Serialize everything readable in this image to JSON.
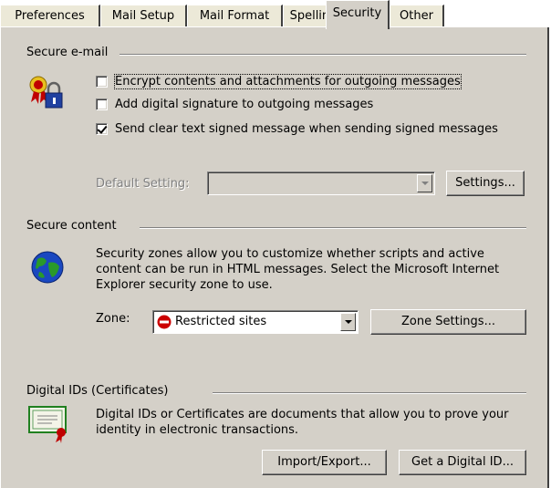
{
  "tabs": [
    {
      "label": "Preferences"
    },
    {
      "label": "Mail Setup"
    },
    {
      "label": "Mail Format"
    },
    {
      "label": "Spelling"
    },
    {
      "label": "Security"
    },
    {
      "label": "Other"
    }
  ],
  "active_tab": "Security",
  "secure_email": {
    "title": "Secure e-mail",
    "icon": "lock-ribbon-icon",
    "encrypt": {
      "label": "Encrypt contents and attachments for outgoing messages",
      "checked": false
    },
    "signature": {
      "label": "Add digital signature to outgoing messages",
      "checked": false
    },
    "clear_text": {
      "label": "Send clear text signed message when sending signed messages",
      "checked": true
    },
    "default_setting_label": "Default Setting:",
    "default_setting_value": "",
    "settings_button": "Settings..."
  },
  "secure_content": {
    "title": "Secure content",
    "icon": "globe-icon",
    "description": "Security zones allow you to customize whether scripts and active content can be run in HTML messages.  Select the Microsoft Internet Explorer security zone to use.",
    "zone_label": "Zone:",
    "zone_value": "Restricted sites",
    "zone_icon": "restricted-icon",
    "zone_settings_button": "Zone Settings..."
  },
  "digital_ids": {
    "title": "Digital IDs (Certificates)",
    "icon": "certificate-icon",
    "description": "Digital IDs or Certificates are documents that allow you to prove your identity in electronic transactions.",
    "import_export_button": "Import/Export...",
    "get_id_button": "Get a Digital ID..."
  },
  "colors": {
    "face": "#d4d0c8",
    "restricted": "#cc0000"
  }
}
